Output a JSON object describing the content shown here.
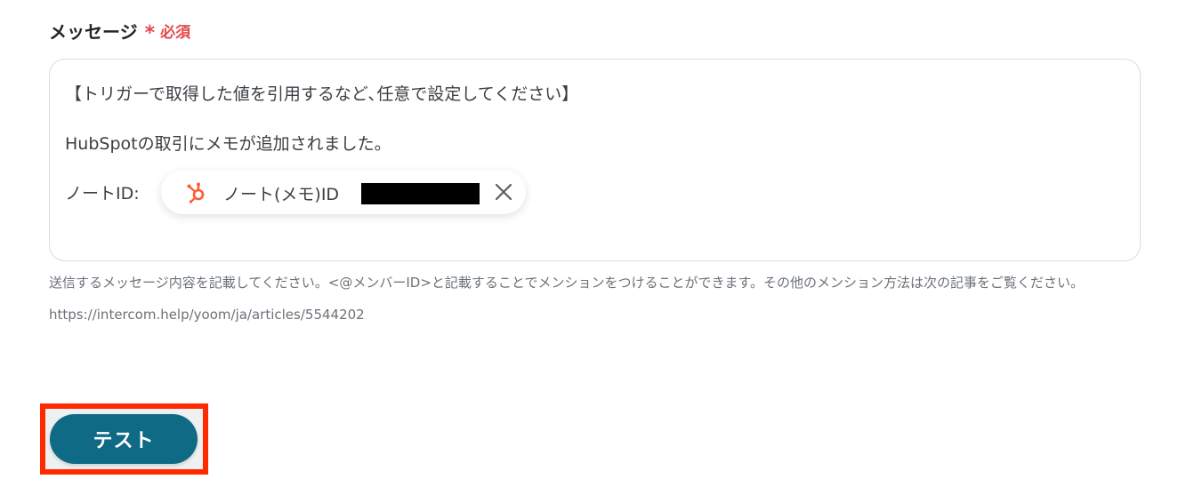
{
  "field": {
    "label": "メッセージ",
    "required_mark": "*",
    "required_text": "必須"
  },
  "message": {
    "line1": "【トリガーで取得した値を引用するなど､任意で設定してください】",
    "line2": "HubSpotの取引にメモが追加されました。",
    "line3_prefix": "ノートID:",
    "chip": {
      "icon": "hubspot-icon",
      "label": "ノート(メモ)ID",
      "remove_icon": "close-icon"
    }
  },
  "helper_text": "送信するメッセージ内容を記載してください。<@メンバーID>と記載することでメンションをつけることができます。その他のメンション方法は次の記事をご覧ください。https://intercom.help/yoom/ja/articles/5544202",
  "actions": {
    "test_label": "テスト"
  },
  "colors": {
    "required": "#e5484d",
    "primary_button": "#0e6a85",
    "highlight_border": "#ff2a00",
    "hubspot_orange": "#ff5c35"
  }
}
